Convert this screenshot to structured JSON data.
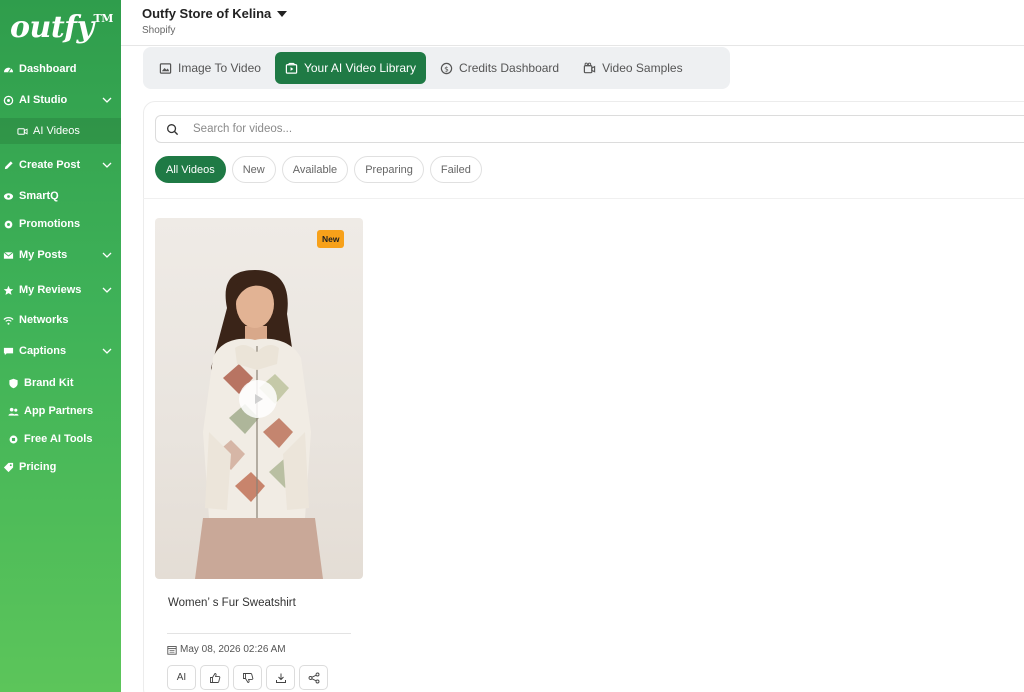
{
  "brand": {
    "logo": "outfy",
    "tm": "TM"
  },
  "sidebar": {
    "items": [
      {
        "label": "Dashboard",
        "icon": "dashboard-icon"
      },
      {
        "label": "AI Studio",
        "icon": "ai-studio-icon",
        "expandable": true
      },
      {
        "label": "AI Videos",
        "icon": "video-camera-icon",
        "active": true
      },
      {
        "label": "Create Post",
        "icon": "pencil-icon",
        "expandable": true
      },
      {
        "label": "SmartQ",
        "icon": "smartq-icon"
      },
      {
        "label": "Promotions",
        "icon": "gear-icon"
      },
      {
        "label": "My Posts",
        "icon": "envelope-icon",
        "expandable": true
      },
      {
        "label": "My Reviews",
        "icon": "star-icon",
        "expandable": true
      },
      {
        "label": "Networks",
        "icon": "wifi-icon"
      },
      {
        "label": "Captions",
        "icon": "comment-icon",
        "expandable": true
      },
      {
        "label": "Brand Kit",
        "icon": "shield-icon"
      },
      {
        "label": "App Partners",
        "icon": "users-icon"
      },
      {
        "label": "Free AI Tools",
        "icon": "tools-icon"
      },
      {
        "label": "Pricing",
        "icon": "tag-icon"
      }
    ]
  },
  "header": {
    "store_name": "Outfy Store of Kelina",
    "platform": "Shopify"
  },
  "tabs": [
    {
      "label": "Image To Video",
      "icon": "image-icon"
    },
    {
      "label": "Your AI Video Library",
      "icon": "video-library-icon",
      "active": true
    },
    {
      "label": "Credits Dashboard",
      "icon": "dollar-circle-icon"
    },
    {
      "label": "Video Samples",
      "icon": "film-icon"
    }
  ],
  "search": {
    "placeholder": "Search for videos..."
  },
  "filters": [
    {
      "label": "All Videos",
      "active": true
    },
    {
      "label": "New"
    },
    {
      "label": "Available"
    },
    {
      "label": "Preparing"
    },
    {
      "label": "Failed"
    }
  ],
  "videos": [
    {
      "badge": "New",
      "title": "Women’ s Fur Sweatshirt",
      "date": "May 08, 2026 02:26 AM",
      "actions": {
        "ai_label": "AI"
      }
    }
  ],
  "colors": {
    "accent": "#1f7a45",
    "sidebar": "#3fb258",
    "badge": "#f7a11a"
  }
}
